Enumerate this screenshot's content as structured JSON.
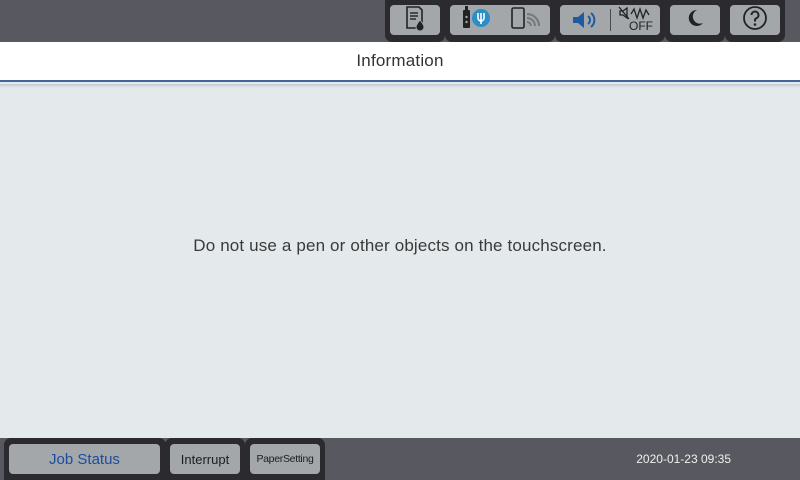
{
  "topbar": {
    "icons": [
      "document-toner-icon",
      "usb-device-icon",
      "wifi-direct-icon",
      "speaker-volume-icon",
      "mute-off-icon",
      "sleep-moon-icon",
      "help-icon"
    ],
    "mute_label": "OFF"
  },
  "title": "Information",
  "message": "Do not use a pen or other objects on the touchscreen.",
  "bottombar": {
    "job_status": "Job Status",
    "interrupt": "Interrupt",
    "paper_setting": "PaperSetting",
    "datetime": "2020-01-23 09:35"
  },
  "colors": {
    "job_status_text": "#1d4da0",
    "usb_badge": "#2a8ec8",
    "title_underline": "#3d6898"
  }
}
